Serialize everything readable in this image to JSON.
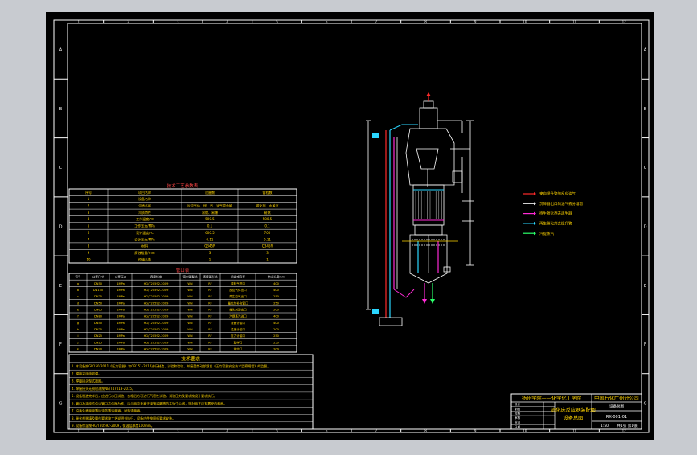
{
  "border": {
    "top_numbers": [
      "1",
      "2",
      "3",
      "4",
      "5",
      "6",
      "7",
      "8",
      "9",
      "10",
      "11",
      "12"
    ],
    "side_letters": [
      "A",
      "B",
      "C",
      "D",
      "E",
      "F",
      "G"
    ]
  },
  "process_table": {
    "title": "技术工艺参数表",
    "headers": [
      "序号",
      "项目名称",
      "设备数",
      "管程数"
    ],
    "rows": [
      [
        "1",
        "设备名称",
        "",
        ""
      ],
      [
        "2",
        "介质名称",
        "反应气体、烃、汽、油气混合物",
        "催化剂、水蒸汽"
      ],
      [
        "3",
        "介质特性",
        "易燃、易爆",
        "易燃"
      ],
      [
        "4",
        "工作温度/℃",
        "500.5",
        "580.5"
      ],
      [
        "5",
        "工作压力/MPa",
        "0.1",
        "0.1"
      ],
      [
        "6",
        "设计温度/℃",
        "600.5",
        "700"
      ],
      [
        "7",
        "设计压力/MPa",
        "0.11",
        "0.11"
      ],
      [
        "8",
        "材料",
        "Q345R",
        "Q345R"
      ],
      [
        "9",
        "腐蚀裕量/mm",
        "3",
        "3"
      ],
      [
        "10",
        "焊缝系数",
        "1",
        "1"
      ]
    ]
  },
  "nozzle_table": {
    "title": "管口表",
    "headers": [
      "符号",
      "公称尺寸",
      "公称压力",
      "连接标准",
      "密封面型式",
      "连接面形式",
      "用途或名称",
      "伸出长度mm"
    ],
    "rows": [
      [
        "a",
        "DN50",
        "1MPa",
        "HG/T20592-2009",
        "WN",
        "RF",
        "原料气进口",
        "400"
      ],
      [
        "b",
        "DN150",
        "1MPa",
        "HG/T20592-2009",
        "WN",
        "RF",
        "反应气体出口",
        "400"
      ],
      [
        "c",
        "DN25",
        "1MPa",
        "HG/T20592-2009",
        "WN",
        "RF",
        "再生空气出口",
        "250"
      ],
      [
        "d",
        "DN50",
        "1MPa",
        "HG/T20592-2009",
        "WN",
        "RF",
        "催化剂补充管口",
        "250"
      ],
      [
        "e",
        "DN65",
        "1MPa",
        "HG/T20592-2009",
        "WN",
        "RF",
        "催化剂卸出口",
        "200"
      ],
      [
        "f",
        "DN80",
        "1MPa",
        "HG/T20592-2009",
        "WN",
        "RF",
        "汽提蒸汽进口",
        "400"
      ],
      [
        "g",
        "DN50",
        "1MPa",
        "HG/T20592-2009",
        "WN",
        "RF",
        "液面计接口",
        "400"
      ],
      [
        "h",
        "DN25",
        "1MPa",
        "HG/T20592-2009",
        "WN",
        "RF",
        "温度计接口",
        "200"
      ],
      [
        "i",
        "DN25",
        "1MPa",
        "HG/T20592-2009",
        "WN",
        "RF",
        "压力计接口",
        "250"
      ],
      [
        "j",
        "DN25",
        "1MPa",
        "HG/T20592-2009",
        "WN",
        "RF",
        "取样口",
        "250"
      ],
      [
        "k",
        "DN20",
        "1MPa",
        "HG/T20592-2009",
        "WN",
        "RF",
        "放空口",
        "200"
      ]
    ]
  },
  "tech_requirements": {
    "title": "技术要求",
    "lines": [
      "1. 本设备按GB150-2011《压力容器》和GB151-2014进行制造、试验和验收，并接受劳动部颁发《压力容器安全技术监察规程》的监督。",
      "2. 焊接采用电弧焊。",
      "3. 焊接接头型式按图。",
      "4. 焊接接头无损检测按NB/T47013-2015。",
      "5. 设备制造完毕后，应进行水压试验，合格后方可进行气密性试验，试验压力及要求按设计要求执行。",
      "6. 管口及支座方位以管口方位图为准，法兰面应垂直于接管或圆筒的主轴中心线，密封面不应有贯穿的划痕。",
      "7. 设备外表面除锈后涂防锈漆两遍，耐热漆两遍。",
      "8. 催化剂装填及操作要求按工艺说明书执行，设备内件按图纸要求安装。",
      "9. 设备保温按HG/T20592-2009，保温层厚度100mm。"
    ]
  },
  "legend": {
    "items": [
      {
        "color": "#ff2a2a",
        "label": "来自提升管的反应油气"
      },
      {
        "color": "#e8e8e8",
        "label": "沉降器出口的油气去分馏塔"
      },
      {
        "color": "#ff2ad6",
        "label": "待生催化剂去再生器"
      },
      {
        "color": "#2ad6ff",
        "label": "再生催化剂去提升管"
      },
      {
        "color": "#2aff6a",
        "label": "汽提蒸汽"
      }
    ]
  },
  "title_block": {
    "school": "扬州学院——化学化工学院",
    "company": "中国石化广州分公司",
    "drawing_title": "流化床反应器装配图",
    "drawing_subtitle": "设备总图",
    "drawing_no": "RX-001-01",
    "scale_label": "1:50",
    "sheet_label": "共1张 第1张",
    "small_labels": [
      "设计",
      "制图",
      "校核",
      "审核",
      "批准",
      "日期"
    ]
  },
  "colors": {
    "frame": "#ffffff",
    "equipment": "#e6e6e6",
    "accent_red": "#ff2a2a",
    "accent_cyan": "#2ad6ff",
    "accent_magenta": "#ff2ad6",
    "accent_green": "#2aff6a",
    "accent_yellow": "#ffd400"
  }
}
